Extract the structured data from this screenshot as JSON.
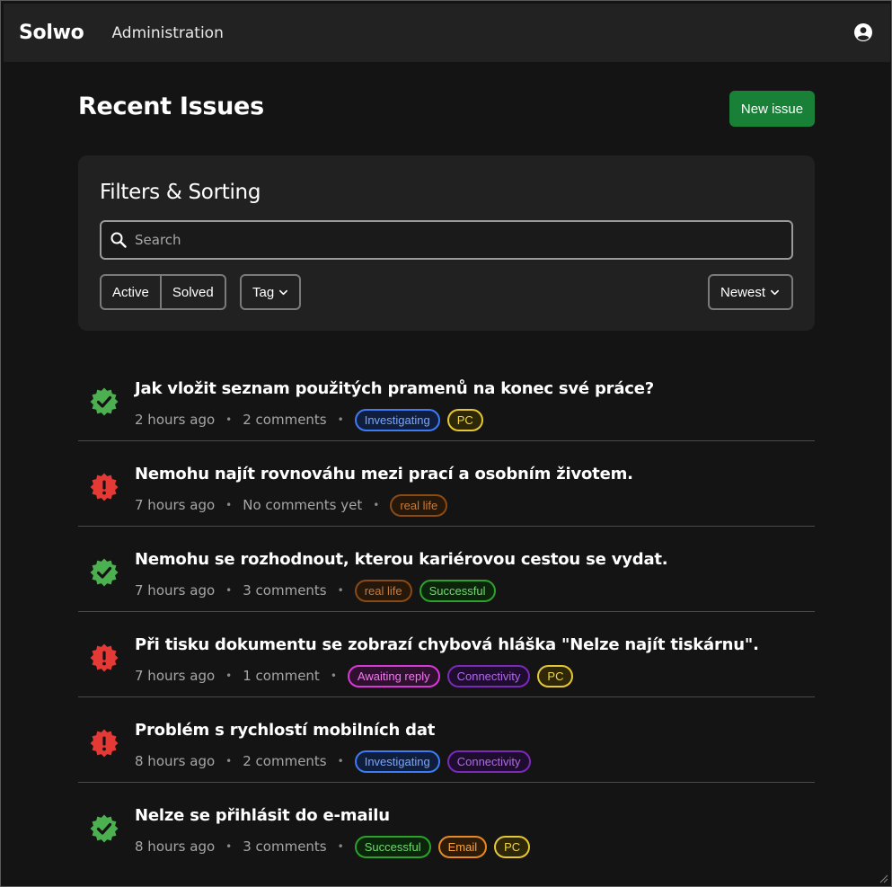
{
  "navbar": {
    "brand": "Solwo",
    "admin_link": "Administration",
    "user_icon": "user-circle-icon"
  },
  "header": {
    "title": "Recent Issues",
    "new_issue_label": "New issue"
  },
  "filters": {
    "title": "Filters & Sorting",
    "search_placeholder": "Search",
    "search_value": "",
    "status_active": "Active",
    "status_solved": "Solved",
    "tag_label": "Tag",
    "sort_label": "Newest"
  },
  "colors": {
    "brand_green": "#198038",
    "solved": "#4caf50",
    "unsolved": "#e53935"
  },
  "issues": [
    {
      "title": "Jak vložit seznam použitých pramenů na konec své práce?",
      "time": "2 hours ago",
      "comments": "2 comments",
      "status": "solved",
      "tags": [
        {
          "label": "Investigating",
          "color": "#3d7bf5",
          "text": "#7aa6ff",
          "bg": "#0f1e3d"
        },
        {
          "label": "PC",
          "color": "#e5c735",
          "text": "#f2d54a",
          "bg": "#2e2808"
        }
      ]
    },
    {
      "title": "Nemohu najít rovnováhu mezi prací a osobním životem.",
      "time": "7 hours ago",
      "comments": "No comments yet",
      "status": "unsolved",
      "tags": [
        {
          "label": "real life",
          "color": "#8a4a14",
          "text": "#c77b3c",
          "bg": "#25170a"
        }
      ]
    },
    {
      "title": "Nemohu se rozhodnout, kterou kariérovou cestou se vydat.",
      "time": "7 hours ago",
      "comments": "3 comments",
      "status": "solved",
      "tags": [
        {
          "label": "real life",
          "color": "#8a4a14",
          "text": "#c77b3c",
          "bg": "#25170a"
        },
        {
          "label": "Successful",
          "color": "#2ea02e",
          "text": "#6fdb6f",
          "bg": "#0b250b"
        }
      ]
    },
    {
      "title": "Při tisku dokumentu se zobrazí chybová hláška \"Nelze najít tiskárnu\".",
      "time": "7 hours ago",
      "comments": "1 comment",
      "status": "unsolved",
      "tags": [
        {
          "label": "Awaiting reply",
          "color": "#d43ad4",
          "text": "#f07af0",
          "bg": "#30102f"
        },
        {
          "label": "Connectivity",
          "color": "#7a2ab5",
          "text": "#b06ae5",
          "bg": "#1e0d2e"
        },
        {
          "label": "PC",
          "color": "#e5c735",
          "text": "#f2d54a",
          "bg": "#2e2808"
        }
      ]
    },
    {
      "title": "Problém s rychlostí mobilních dat",
      "time": "8 hours ago",
      "comments": "2 comments",
      "status": "unsolved",
      "tags": [
        {
          "label": "Investigating",
          "color": "#3d7bf5",
          "text": "#7aa6ff",
          "bg": "#0f1e3d"
        },
        {
          "label": "Connectivity",
          "color": "#7a2ab5",
          "text": "#b06ae5",
          "bg": "#1e0d2e"
        }
      ]
    },
    {
      "title": "Nelze se přihlásit do e-mailu",
      "time": "8 hours ago",
      "comments": "3 comments",
      "status": "solved",
      "tags": [
        {
          "label": "Successful",
          "color": "#2ea02e",
          "text": "#6fdb6f",
          "bg": "#0b250b"
        },
        {
          "label": "Email",
          "color": "#e58a24",
          "text": "#f5a44a",
          "bg": "#2e1c08"
        },
        {
          "label": "PC",
          "color": "#e5c735",
          "text": "#f2d54a",
          "bg": "#2e2808"
        }
      ]
    }
  ]
}
